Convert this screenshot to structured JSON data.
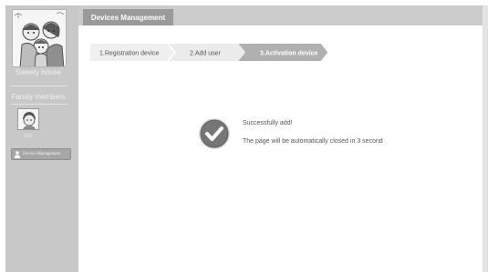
{
  "sidebar": {
    "house_name": "Sweety house",
    "members_title": "Family members",
    "members": [
      {
        "name": "Mm"
      }
    ],
    "manage_button_label": "Device Management"
  },
  "header": {
    "tab_title": "Devices Management"
  },
  "steps": [
    {
      "label": "1.Registration device",
      "state": "done"
    },
    {
      "label": "2.Add user",
      "state": "done"
    },
    {
      "label": "3.Activation device",
      "state": "active"
    }
  ],
  "status": {
    "title": "Successfully add!",
    "message": "The page will be automatically closed in 3 second"
  },
  "colors": {
    "sidebar_bg": "#c8c8c8",
    "header_bg": "#cbcbcb",
    "active_tab_bg": "#9a9a9a",
    "step_active_bg": "#b0b0b0",
    "step_inactive_bg": "#ececec",
    "success_icon_bg": "#767676"
  },
  "icons": {
    "success": "check-circle-icon",
    "manage": "user-icon"
  }
}
